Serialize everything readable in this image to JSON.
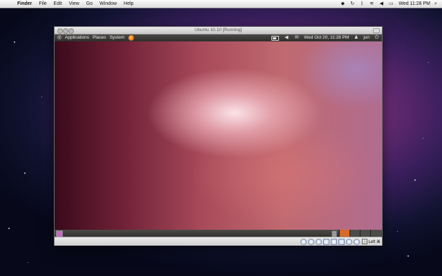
{
  "mac_menubar": {
    "apple_icon": "apple-icon",
    "items": [
      "Finder",
      "File",
      "Edit",
      "View",
      "Go",
      "Window",
      "Help"
    ],
    "status_icons": [
      "wifi-icon",
      "volume-icon",
      "battery-icon"
    ],
    "clock": "Wed 11:28 PM"
  },
  "vm_window": {
    "title": "Ubuntu 10.10 [Running]"
  },
  "ubuntu_panel": {
    "menus": [
      "Applications",
      "Places",
      "System"
    ],
    "datetime": "Wed Oct 20, 11:28 PM",
    "user": "jun"
  },
  "vbox_status": {
    "host_key": "Left ⌘"
  },
  "colors": {
    "panel_dark": "#3a3936",
    "wallpaper_accent": "#c06a70",
    "firefox_orange": "#f57b1f"
  }
}
